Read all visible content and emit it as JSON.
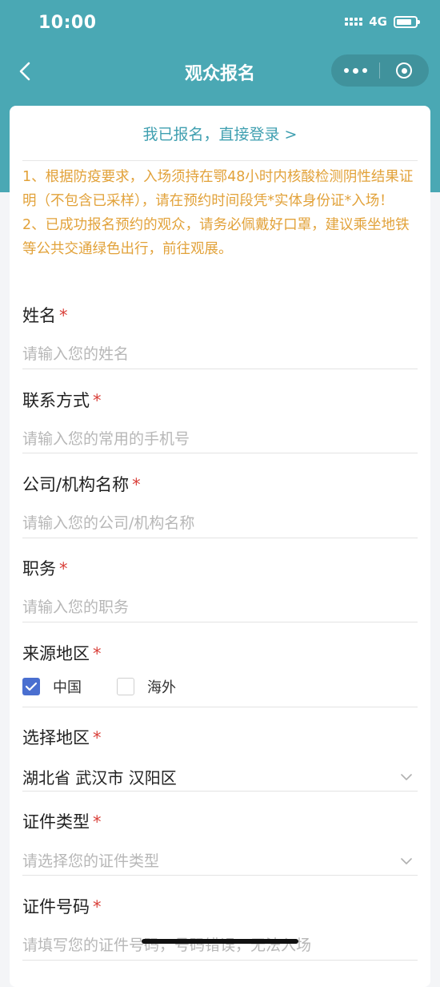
{
  "status": {
    "time": "10:00",
    "network": "4G"
  },
  "nav": {
    "title": "观众报名"
  },
  "login_link": "我已报名，直接登录 >",
  "notice": [
    "1、根据防疫要求，入场须持在鄂48小时内核酸检测阴性结果证明（不包含已采样），请在预约时间段凭*实体身份证*入场！",
    "2、已成功报名预约的观众，请务必佩戴好口罩，建议乘坐地铁等公共交通绿色出行，前往观展。"
  ],
  "required_mark": "*",
  "fields": {
    "name": {
      "label": "姓名",
      "placeholder": "请输入您的姓名"
    },
    "contact": {
      "label": "联系方式",
      "placeholder": "请输入您的常用的手机号"
    },
    "company": {
      "label": "公司/机构名称",
      "placeholder": "请输入您的公司/机构名称"
    },
    "position": {
      "label": "职务",
      "placeholder": "请输入您的职务"
    },
    "source": {
      "label": "来源地区",
      "options": [
        {
          "label": "中国",
          "checked": true
        },
        {
          "label": "海外",
          "checked": false
        }
      ]
    },
    "region": {
      "label": "选择地区",
      "value": "湖北省 武汉市 汉阳区"
    },
    "id_type": {
      "label": "证件类型",
      "placeholder": "请选择您的证件类型"
    },
    "id_number": {
      "label": "证件号码",
      "placeholder": "请填写您的证件号码，号码错误，无法入场"
    }
  },
  "colors": {
    "header": "#4aa8b4",
    "link": "#3f9fb0",
    "notice": "#e2a23a",
    "required": "#d9403a",
    "checkbox": "#4a6fd0"
  }
}
